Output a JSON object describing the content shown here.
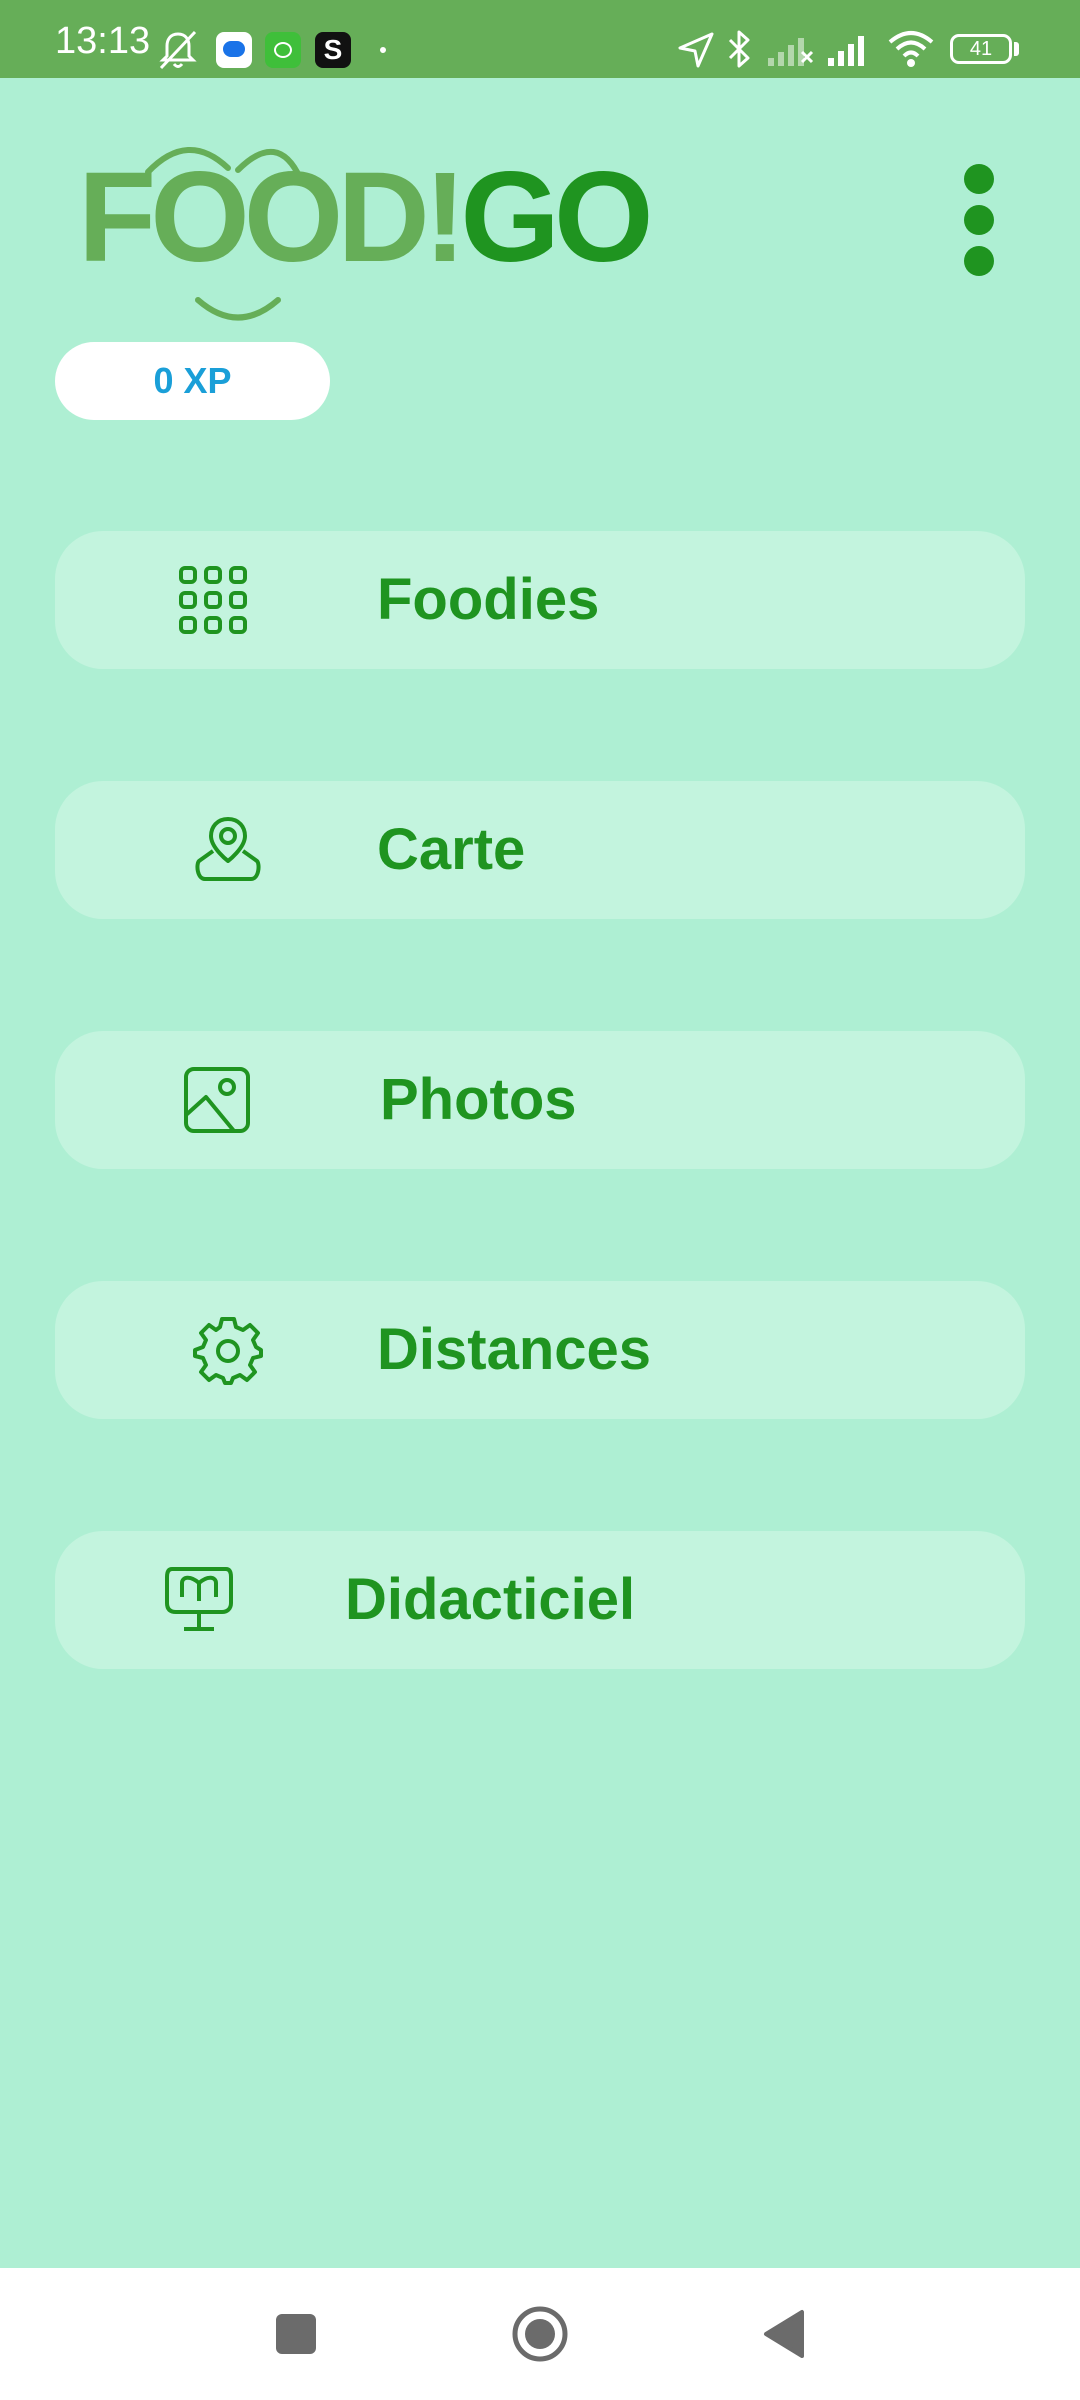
{
  "status_bar": {
    "time": "13:13",
    "battery": "41",
    "icons": [
      "notifications-muted-icon",
      "messages-app-icon",
      "cat-app-icon",
      "s-app-icon",
      "dot-icon",
      "location-icon",
      "bluetooth-icon",
      "signal-off-icon",
      "signal-icon",
      "wifi-icon",
      "battery-icon"
    ]
  },
  "header": {
    "logo_part1": "FOOD!",
    "logo_part2": "GO",
    "menu_icon": "more-vertical-icon",
    "xp": "0 XP"
  },
  "menu": {
    "items": [
      {
        "label": "Foodies",
        "icon": "grid-icon"
      },
      {
        "label": "Carte",
        "icon": "map-pin-icon"
      },
      {
        "label": "Photos",
        "icon": "image-icon"
      },
      {
        "label": "Distances",
        "icon": "gear-icon"
      },
      {
        "label": "Didacticiel",
        "icon": "tutorial-board-icon"
      }
    ]
  },
  "nav_bar": {
    "icons": [
      "recents-square-icon",
      "home-circle-icon",
      "back-triangle-icon"
    ]
  },
  "colors": {
    "background": "#aeefd3",
    "status_bar": "#66ae58",
    "button": "#c3f4de",
    "accent_green": "#1f9420",
    "light_green": "#66ae58",
    "xp_blue": "#1a9fd8"
  }
}
